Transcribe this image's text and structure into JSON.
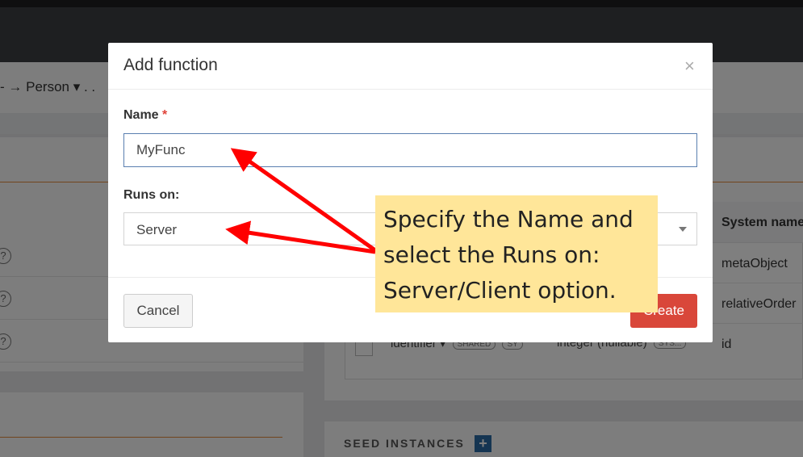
{
  "background": {
    "breadcrumb": "→ Person ▾ . .",
    "breadcrumb_prefix": "-",
    "table": {
      "column_header": "System name",
      "rows": [
        "metaObject",
        "relativeOrder",
        "id"
      ],
      "row3_field": "identifier ▾",
      "row3_badge_shared": "SHARED",
      "row3_badge_sys": "SY",
      "row3_type": "integer (nullable)",
      "row3_type_badge": "SYS..."
    },
    "help_glyph": "?",
    "seed_instances_label": "SEED INSTANCES",
    "seed_add_glyph": "+"
  },
  "modal": {
    "title": "Add function",
    "close_glyph": "×",
    "name_label": "Name",
    "required_mark": "*",
    "name_value": "MyFunc",
    "runs_on_label": "Runs on:",
    "runs_on_value": "Server",
    "cancel_label": "Cancel",
    "create_label": "Create"
  },
  "annotation": {
    "lines": [
      "Specify the Name and",
      "select the Runs on:",
      "Server/Client option."
    ],
    "box_color": "#ffe699",
    "arrow_color": "#ff0000"
  },
  "colors": {
    "create_button": "#d9473a",
    "accent_orange": "#e38b3a",
    "seed_add_button": "#2a6aa5"
  }
}
